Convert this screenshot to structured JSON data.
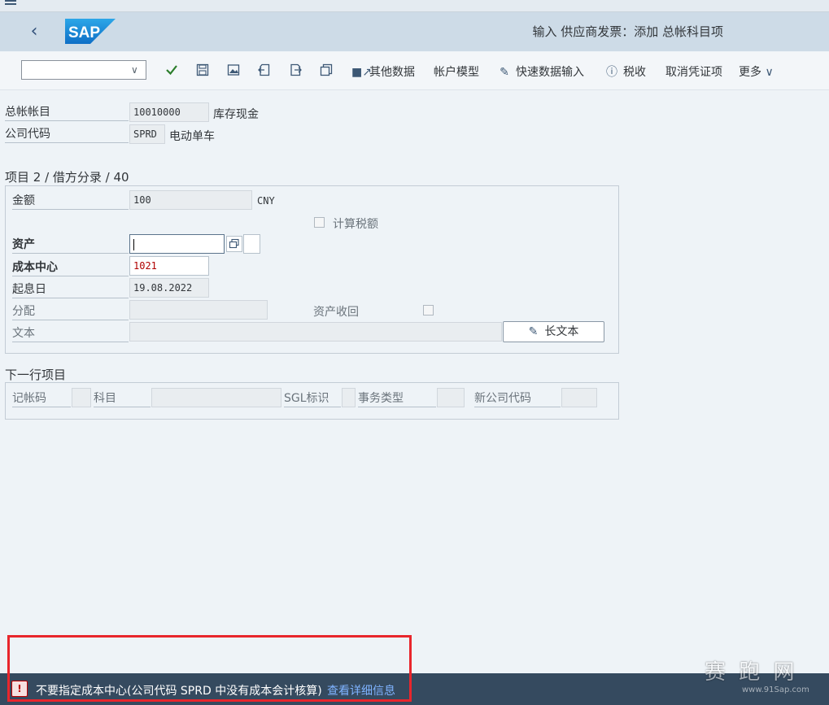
{
  "header": {
    "title": "输入 供应商发票：添加 总帐科目项",
    "logo": "SAP"
  },
  "toolbar": {
    "combo_value": "",
    "buttons": {
      "other_data": "其他数据",
      "account_model": "帐户模型",
      "fast_entry": "快速数据输入",
      "tax": "税收",
      "cancel_item": "取消凭证项",
      "more": "更多"
    }
  },
  "top_fields": {
    "gl_account_label": "总帐帐目",
    "gl_account_value": "10010000",
    "gl_account_desc": "库存现金",
    "company_code_label": "公司代码",
    "company_code_value": "SPRD",
    "company_code_desc": "电动单车"
  },
  "item": {
    "title": "项目 2 / 借方分录 / 40",
    "amount_label": "金额",
    "amount_value": "100",
    "currency": "CNY",
    "calc_tax_label": "计算税额",
    "asset_label": "资产",
    "asset_value": "",
    "cost_center_label": "成本中心",
    "cost_center_value": "1021",
    "value_date_label": "起息日",
    "value_date_value": "19.08.2022",
    "assignment_label": "分配",
    "assignment_value": "",
    "asset_retirement_label": "资产收回",
    "text_label": "文本",
    "text_value": "",
    "long_text_button": "长文本"
  },
  "next_item": {
    "title": "下一行项目",
    "posting_key_label": "记帐码",
    "account_label": "科目",
    "sgl_label": "SGL标识",
    "trans_type_label": "事务类型",
    "new_company_label": "新公司代码"
  },
  "status": {
    "message": "不要指定成本中心(公司代码 SPRD 中没有成本会计核算)",
    "link": "查看详细信息"
  },
  "watermark": {
    "text": "赛 跑 网",
    "url": "www.91Sap.com"
  },
  "colors": {
    "header_bg": "#cddbe7",
    "status_bg": "#354a5f",
    "highlight_red": "#e8262c",
    "sap_blue": "#1a7fd4"
  }
}
